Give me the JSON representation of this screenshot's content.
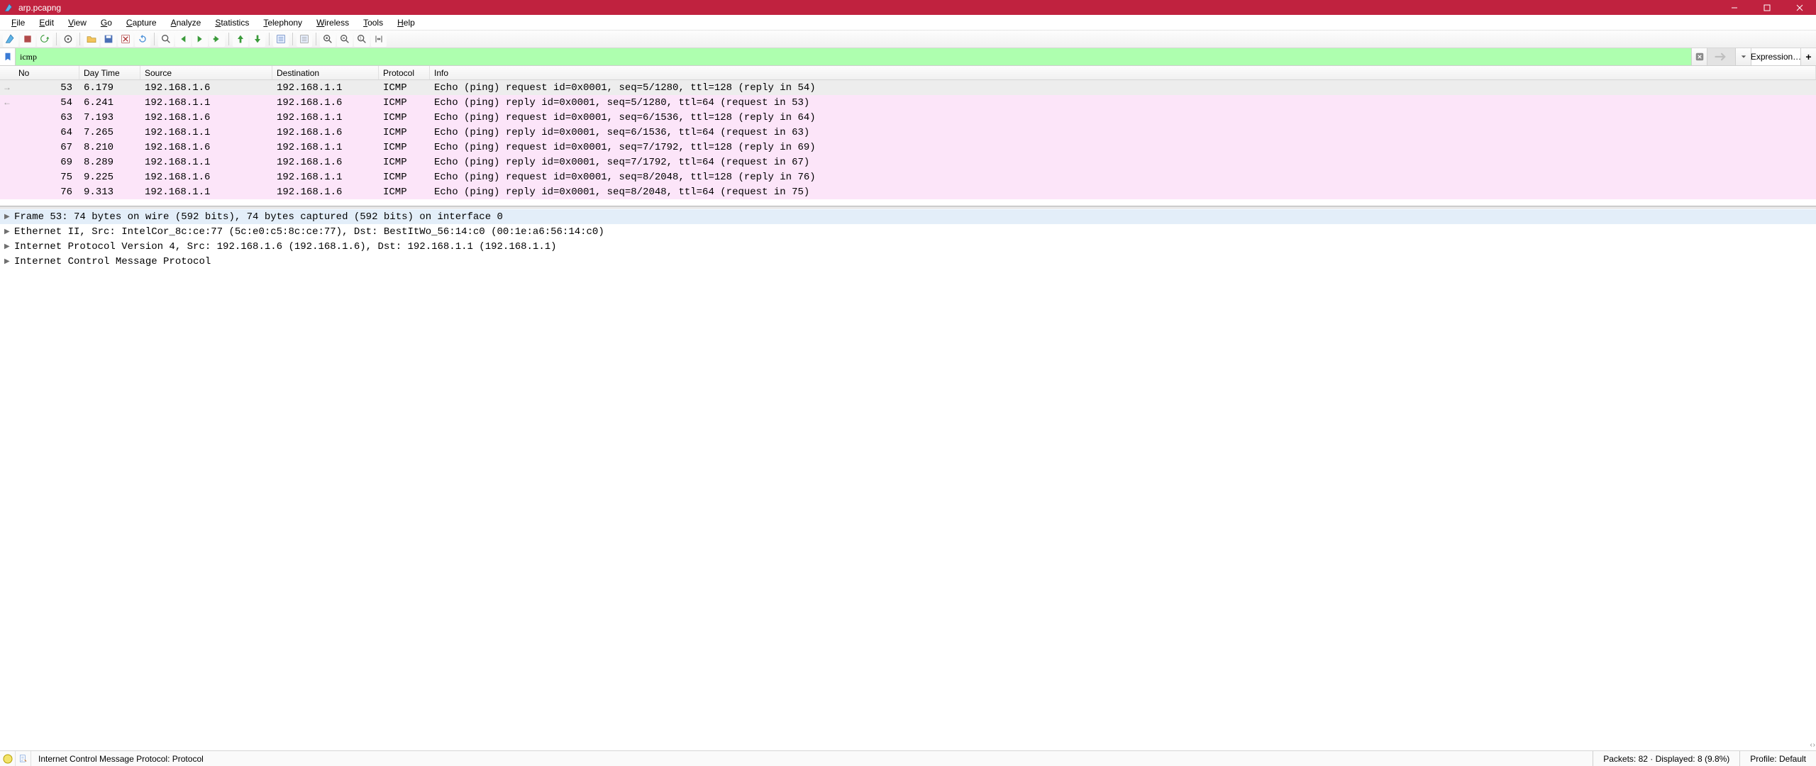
{
  "window": {
    "title": "arp.pcapng"
  },
  "menus": [
    "File",
    "Edit",
    "View",
    "Go",
    "Capture",
    "Analyze",
    "Statistics",
    "Telephony",
    "Wireless",
    "Tools",
    "Help"
  ],
  "filter": {
    "value": "icmp",
    "expression_label": "Expression…"
  },
  "columns": {
    "no": "No",
    "time": "Day Time",
    "source": "Source",
    "dest": "Destination",
    "proto": "Protocol",
    "info": "Info"
  },
  "packets": [
    {
      "marker": "→",
      "no": "53",
      "time": "6.179",
      "src": "192.168.1.6",
      "dst": "192.168.1.1",
      "proto": "ICMP",
      "info": "Echo (ping) request  id=0x0001, seq=5/1280, ttl=128 (reply in 54)",
      "cls": "sel"
    },
    {
      "marker": "←",
      "no": "54",
      "time": "6.241",
      "src": "192.168.1.1",
      "dst": "192.168.1.6",
      "proto": "ICMP",
      "info": "Echo (ping) reply    id=0x0001, seq=5/1280, ttl=64 (request in 53)",
      "cls": "pink"
    },
    {
      "marker": "",
      "no": "63",
      "time": "7.193",
      "src": "192.168.1.6",
      "dst": "192.168.1.1",
      "proto": "ICMP",
      "info": "Echo (ping) request  id=0x0001, seq=6/1536, ttl=128 (reply in 64)",
      "cls": "pink"
    },
    {
      "marker": "",
      "no": "64",
      "time": "7.265",
      "src": "192.168.1.1",
      "dst": "192.168.1.6",
      "proto": "ICMP",
      "info": "Echo (ping) reply    id=0x0001, seq=6/1536, ttl=64 (request in 63)",
      "cls": "pink"
    },
    {
      "marker": "",
      "no": "67",
      "time": "8.210",
      "src": "192.168.1.6",
      "dst": "192.168.1.1",
      "proto": "ICMP",
      "info": "Echo (ping) request  id=0x0001, seq=7/1792, ttl=128 (reply in 69)",
      "cls": "pink"
    },
    {
      "marker": "",
      "no": "69",
      "time": "8.289",
      "src": "192.168.1.1",
      "dst": "192.168.1.6",
      "proto": "ICMP",
      "info": "Echo (ping) reply    id=0x0001, seq=7/1792, ttl=64 (request in 67)",
      "cls": "pink"
    },
    {
      "marker": "",
      "no": "75",
      "time": "9.225",
      "src": "192.168.1.6",
      "dst": "192.168.1.1",
      "proto": "ICMP",
      "info": "Echo (ping) request  id=0x0001, seq=8/2048, ttl=128 (reply in 76)",
      "cls": "pink"
    },
    {
      "marker": "",
      "no": "76",
      "time": "9.313",
      "src": "192.168.1.1",
      "dst": "192.168.1.6",
      "proto": "ICMP",
      "info": "Echo (ping) reply    id=0x0001, seq=8/2048, ttl=64 (request in 75)",
      "cls": "pink"
    }
  ],
  "details": [
    {
      "text": "Frame 53: 74 bytes on wire (592 bits), 74 bytes captured (592 bits) on interface 0",
      "selected": true
    },
    {
      "text": "Ethernet II, Src: IntelCor_8c:ce:77 (5c:e0:c5:8c:ce:77), Dst: BestItWo_56:14:c0 (00:1e:a6:56:14:c0)",
      "selected": false
    },
    {
      "text": "Internet Protocol Version 4, Src: 192.168.1.6 (192.168.1.6), Dst: 192.168.1.1 (192.168.1.1)",
      "selected": false
    },
    {
      "text": "Internet Control Message Protocol",
      "selected": false
    }
  ],
  "status": {
    "hint": "Internet Control Message Protocol: Protocol",
    "packets": "Packets: 82 · Displayed: 8 (9.8%)",
    "profile": "Profile: Default"
  },
  "toolbar": [
    "shark-fin",
    "stop",
    "restart",
    "sep",
    "options",
    "sep",
    "open",
    "save",
    "close",
    "reload",
    "sep",
    "find",
    "prev",
    "next",
    "goto",
    "sep",
    "first",
    "last",
    "sep",
    "auto-scroll",
    "sep",
    "colorize",
    "sep",
    "zoom-in",
    "zoom-out",
    "zoom-reset",
    "resize-cols"
  ]
}
